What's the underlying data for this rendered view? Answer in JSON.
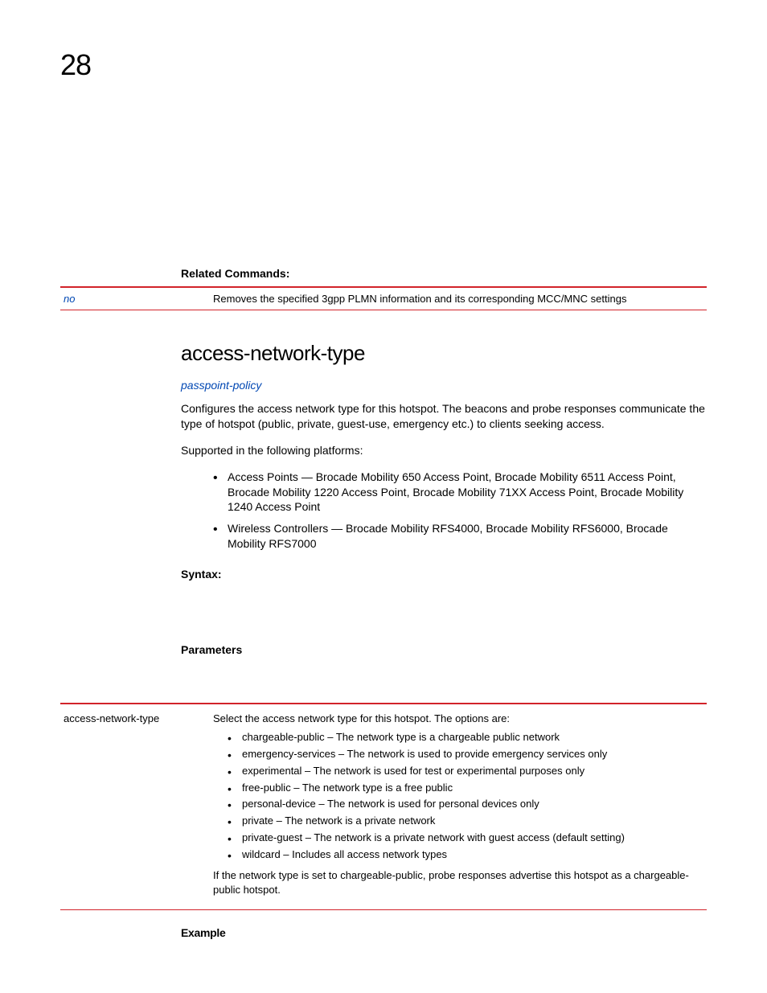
{
  "pageNumber": "28",
  "relatedCommands": {
    "heading": "Related Commands:",
    "row": {
      "cmd": "no",
      "desc": "Removes the specified 3gpp PLMN information and its corresponding MCC/MNC settings"
    }
  },
  "cmdTitle": "access-network-type",
  "policyLink": "passpoint-policy",
  "intro": "Configures the access network type for this hotspot. The beacons and probe responses communicate the type of hotspot (public, private, guest-use, emergency etc.) to clients seeking access.",
  "supportedLine": "Supported in the following platforms:",
  "platforms": [
    "Access Points — Brocade Mobility 650 Access Point, Brocade Mobility 6511 Access Point, Brocade Mobility 1220 Access Point, Brocade Mobility 71XX Access Point, Brocade Mobility 1240 Access Point",
    "Wireless Controllers — Brocade Mobility RFS4000, Brocade Mobility RFS6000, Brocade Mobility RFS7000"
  ],
  "syntaxHeading": "Syntax:",
  "paramsHeading": "Parameters",
  "paramTable": {
    "left": "access-network-type",
    "intro": "Select the access network type for this hotspot. The options are:",
    "options": [
      "chargeable-public – The network type is a chargeable public network",
      "emergency-services – The network is used to provide emergency services only",
      "experimental – The network is used for test or experimental purposes only",
      "free-public – The network type is a free public",
      "personal-device – The network is used for personal devices only",
      "private – The network is a private network",
      "private-guest – The network is a private network with guest access (default setting)",
      "wildcard – Includes all access network types"
    ],
    "outro": "If the network type is set to chargeable-public, probe responses advertise this hotspot as a chargeable-public hotspot."
  },
  "exampleHeading": "Example"
}
